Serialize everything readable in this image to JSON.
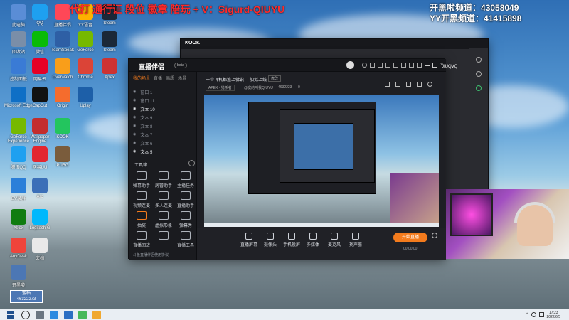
{
  "overlay": {
    "left_text": "代打 通行证 段位 徽章 陪玩 + V：Sigurd-QIUYU",
    "right_line1_label": "开黑啦频道：",
    "right_line1_value": "43058049",
    "right_line2_label": "YY开黑频道：",
    "right_line2_value": "41415898"
  },
  "desktop_icons": [
    "此电脑",
    "QQ",
    "直播伴侣",
    "YY语音",
    "Steam",
    "回收站",
    "微信",
    "TeamSpeak",
    "GeForce",
    "Steam",
    "控制面板",
    "网易云",
    "Overwatch",
    "Chrome",
    "Apex",
    "Microsoft Edge",
    "CapCut",
    "Origin",
    "Uplay",
    "GeForce Experience",
    "Wallpaper Engine",
    "KOOK",
    "腾讯QQ",
    "网易UU",
    "PUBG",
    "EV录屏",
    "Arc",
    "Xbox",
    "Logitech G",
    "AnyDesk",
    "文档",
    "开黑啦"
  ],
  "bottom_left": {
    "name": "蜜柚",
    "id": "46322273"
  },
  "main_window": {
    "logo": "直播伴侣",
    "logo_tag": "beta",
    "tabs": [
      "我的场景",
      "直播",
      "画质",
      "场景"
    ],
    "sources": [
      "窗口 1",
      "窗口 11",
      "文本 10",
      "文本 9",
      "文本 8",
      "文本 7",
      "文本 6",
      "文本 5"
    ],
    "tools_title": "工具箱",
    "tools": [
      "弹幕助手",
      "房管助手",
      "主播任务",
      "视频连麦",
      "多人连麦",
      "直播助手",
      "抽奖",
      "虚拟形象",
      "弹幕秀",
      "直播回放",
      "",
      "直播工具"
    ],
    "stream_title": "一个飞机都追上佛说！-加拟上线",
    "stream_badge": "修改",
    "stream_category": "APEX · 猎杀者",
    "stream_user": "@宽的叫我QIUYU",
    "stream_id": "4632223",
    "viewer_count": "0",
    "bottom_tools": [
      "直播屏幕",
      "摄像头",
      "手机投屏",
      "多媒体",
      "麦克风",
      "扬声器"
    ],
    "start_button": "开始直播",
    "timer": "00:00:00",
    "footer_note": "斗鱼直播伴侣使用协议",
    "account": "JIUQVQ"
  },
  "kook_window": {
    "title": "KOOK"
  },
  "taskbar": {
    "time": "17:23",
    "date": "2022/6/5"
  },
  "colors": {
    "accent_orange": "#f37b1d",
    "window_bg": "#1e1f24",
    "overlay_red": "#ff2a2a",
    "overlay_white": "#ffffff"
  }
}
